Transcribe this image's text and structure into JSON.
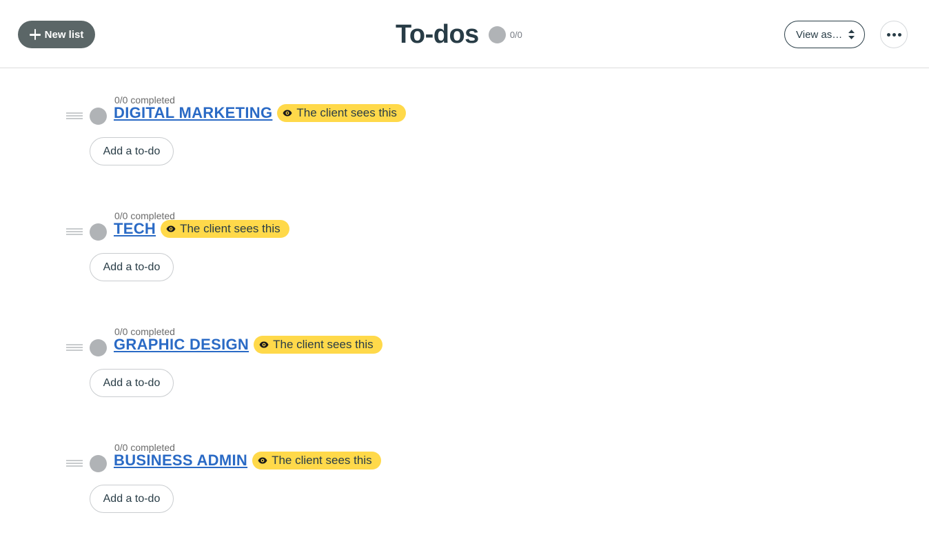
{
  "header": {
    "new_list_label": "New list",
    "title": "To-dos",
    "progress": "0/0",
    "view_as_label": "View as…"
  },
  "lists": [
    {
      "completed": "0/0 completed",
      "title": "DIGITAL MARKETING",
      "badge": "The client sees this",
      "add_label": "Add a to-do"
    },
    {
      "completed": "0/0 completed",
      "title": "TECH",
      "badge": "The client sees this",
      "add_label": "Add a to-do"
    },
    {
      "completed": "0/0 completed",
      "title": "GRAPHIC DESIGN",
      "badge": "The client sees this",
      "add_label": "Add a to-do"
    },
    {
      "completed": "0/0 completed",
      "title": "BUSINESS ADMIN",
      "badge": "The client sees this",
      "add_label": "Add a to-do"
    }
  ],
  "colors": {
    "accent_link": "#2a6ac5",
    "badge_yellow": "#ffd94a",
    "new_list_bg": "#5b6667",
    "progress_dot": "#b0b3b6"
  },
  "icons": [
    "plus-icon",
    "sort-arrows-icon",
    "ellipsis-icon",
    "drag-handle-icon",
    "eye-icon"
  ]
}
